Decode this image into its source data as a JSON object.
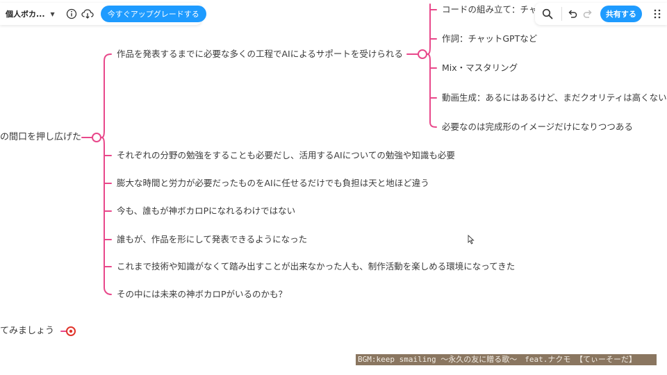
{
  "toolbar": {
    "doc_title": "個人ボカ...",
    "upgrade_label": "今すぐアップグレードする",
    "share_label": "共有する",
    "icons": [
      "info-icon",
      "cloud-download-icon",
      "search-icon",
      "undo-icon",
      "redo-icon",
      "grip-icon"
    ]
  },
  "mindmap": {
    "parent_fragment": "の間口を押し広げた",
    "sibling_fragment": "てみましょう",
    "branch_ai_support": "作品を発表するまでに必要な多くの工程でAIによるサポートを受けられる",
    "sub_items": [
      "コードの組み立て：チャ",
      "作詞：チャットGPTなど",
      "Mix・マスタリング",
      "動画生成：あるにはあるけど、まだクオリティは高くない",
      "必要なのは完成形のイメージだけになりつつある"
    ],
    "points": [
      "それぞれの分野の勉強をすることも必要だし、活用するAIについての勉強や知識も必要",
      "膨大な時間と労力が必要だったものをAIに任せるだけでも負担は天と地ほど違う",
      "今も、誰もが神ボカロPになれるわけではない",
      "誰もが、作品を形にして発表できるようになった",
      "これまで技術や知識がなくて踏み出すことが出来なかった人も、制作活動を楽しめる環境になってきた",
      "その中には未来の神ボカロPがいるのかも？"
    ]
  },
  "colors": {
    "branch": "#e8478a",
    "accent": "#1e9bff",
    "collapsed_node": "#e0342b"
  },
  "bgm_credit": "BGM:keep smailing ～永久の友に贈る歌～　feat.ナクモ 【てぃーそーだ】"
}
